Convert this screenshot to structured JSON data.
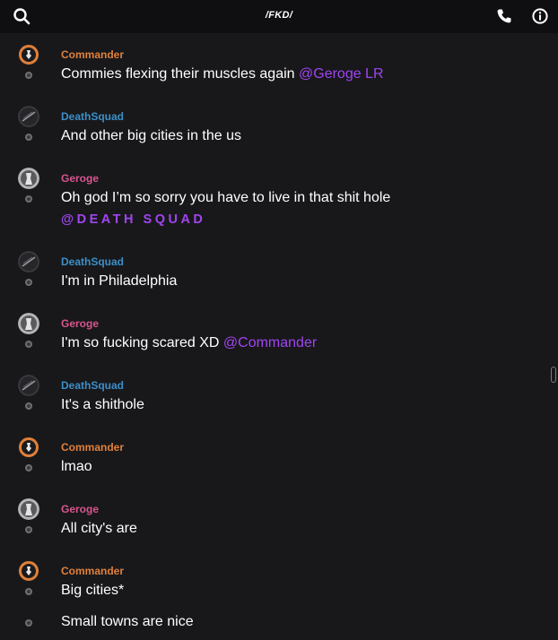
{
  "header": {
    "title": "/FKD/",
    "icons": [
      "search-icon",
      "phone-icon",
      "info-icon"
    ]
  },
  "colors": {
    "background": "#18181b",
    "topbar": "#0f0f11",
    "commander": "#e0803a",
    "death_squad": "#3c8fc8",
    "geroge": "#d8558e",
    "mention": "#a045f0"
  },
  "messages": [
    {
      "user": "Commander",
      "text": "Commies flexing their muscles again",
      "mention": "@Geroge LR"
    },
    {
      "user": "DeathSquad",
      "text": "And other big cities in the us"
    },
    {
      "user": "Geroge",
      "text": "Oh god I’m so sorry you have to live in that shit hole",
      "mention": "@DEATH SQUAD"
    },
    {
      "user": "DeathSquad",
      "text": "I'm in Philadelphia"
    },
    {
      "user": "Geroge",
      "text": "I'm so fucking scared XD",
      "mention": "@Commander"
    },
    {
      "user": "DeathSquad",
      "text": "It's a shithole"
    },
    {
      "user": "Commander",
      "text": "lmao"
    },
    {
      "user": "Geroge",
      "text": "All city's are"
    },
    {
      "user": "Commander",
      "text": "Big cities*"
    },
    {
      "text": "Small towns are nice"
    }
  ]
}
